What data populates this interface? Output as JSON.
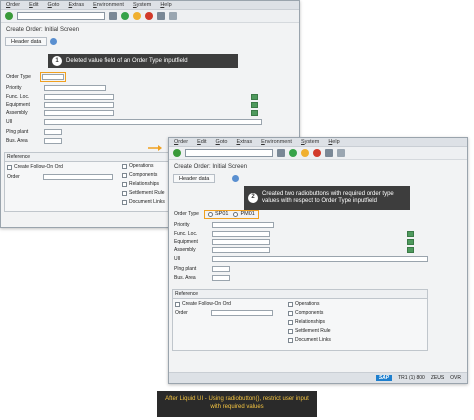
{
  "menu": [
    "Order",
    "Edit",
    "Goto",
    "Extras",
    "Environment",
    "System",
    "Help"
  ],
  "window1": {
    "title": "Create Order: Initial Screen",
    "header_button": "Header data",
    "fields": [
      "Order Type",
      "Priority",
      "Func. Loc.",
      "Equipment",
      "Assembly",
      "UII",
      "Plng plant",
      "Bus. Area"
    ],
    "group_title": "Reference",
    "create_followon": "Create Follow-On Ord",
    "order_label": "Order",
    "checkboxes": [
      "Operations",
      "Components",
      "Relationships",
      "Settlement Rule",
      "Document Links"
    ]
  },
  "window2": {
    "title": "Create Order: Initial Screen",
    "header_button": "Header data",
    "order_type_label": "Order Type",
    "radio_options": [
      "SP01",
      "PM01"
    ],
    "fields": [
      "Priority",
      "Func. Loc.",
      "Equipment",
      "Assembly",
      "UII",
      "Plng plant",
      "Bus. Area"
    ],
    "group_title": "Reference",
    "create_followon": "Create Follow-On Ord",
    "order_label": "Order",
    "checkboxes": [
      "Operations",
      "Components",
      "Relationships",
      "Settlement Rule",
      "Document Links"
    ],
    "status": {
      "sap": "SAP",
      "system": "TR1 (1) 800",
      "server": "ZEUS",
      "mode": "OVR"
    }
  },
  "callout1": {
    "number": "1",
    "text": "Deleted value field of an Order Type inputfield"
  },
  "callout2": {
    "number": "2",
    "text": "Created two radiobuttons with required order type values with respect to Order Type inputfield"
  },
  "caption": "After Liquid UI - Using radiobutton(), restrict user input with required values",
  "colors": {
    "callout_bg": "#3d3d3d",
    "caption_bg": "#2a2a2a",
    "caption_text": "#f5c542",
    "highlight": "#f0a020",
    "sap_blue": "#1e7fce"
  }
}
